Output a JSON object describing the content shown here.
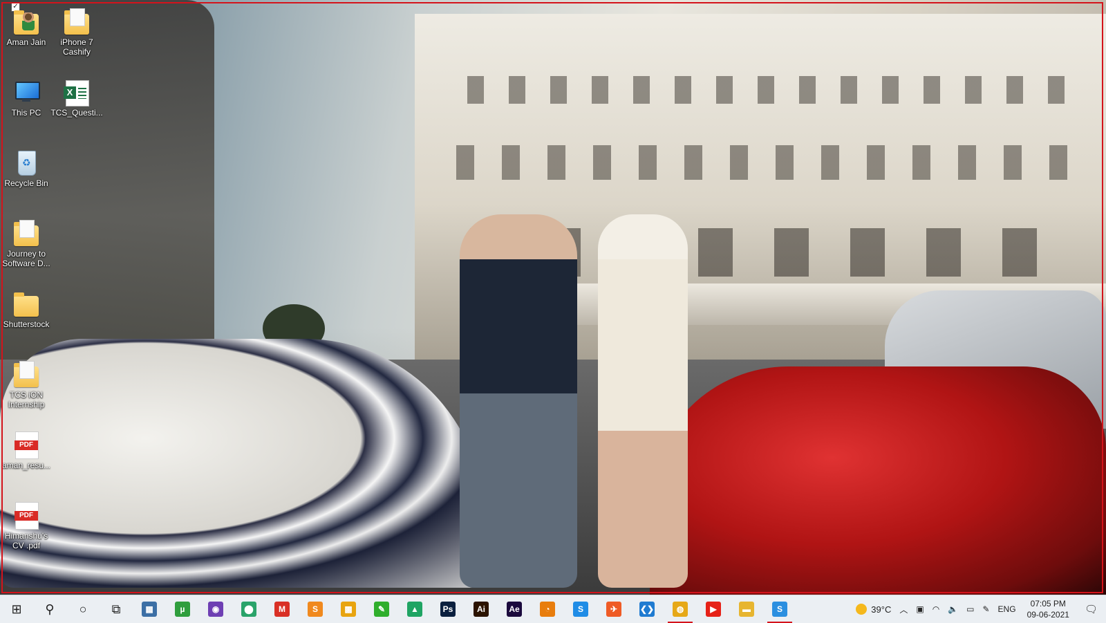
{
  "desktop": {
    "icons": [
      {
        "label": "Aman Jain",
        "icon": "user-folder-icon"
      },
      {
        "label": "iPhone 7 Cashify",
        "icon": "folder-icon"
      },
      {
        "label": "This PC",
        "icon": "this-pc-icon"
      },
      {
        "label": "TCS_Questi...",
        "icon": "excel-file-icon"
      },
      {
        "label": "Recycle Bin",
        "icon": "recycle-bin-icon"
      },
      {
        "label": "Journey to Software D...",
        "icon": "folder-icon"
      },
      {
        "label": "Shutterstock",
        "icon": "folder-icon"
      },
      {
        "label": "TCS iON Internship",
        "icon": "folder-icon"
      },
      {
        "label": "aman_resu...",
        "icon": "pdf-file-icon",
        "badge": "PDF"
      },
      {
        "label": "Himanshu's CV .pdf",
        "icon": "pdf-file-icon",
        "badge": "PDF"
      }
    ],
    "accent_color": "#d4131b"
  },
  "taskbar": {
    "apps": [
      {
        "name": "start-button",
        "icon": "windows-logo-icon",
        "glyph": "⊞",
        "color": "#1f1f1f"
      },
      {
        "name": "search-button",
        "icon": "search-icon",
        "glyph": "⚲",
        "color": "#1f1f1f"
      },
      {
        "name": "cortana-button",
        "icon": "cortana-circle-icon",
        "glyph": "○",
        "color": "#1f1f1f"
      },
      {
        "name": "task-view-button",
        "icon": "task-view-icon",
        "glyph": "⧉",
        "color": "#1f1f1f"
      },
      {
        "name": "calculator",
        "icon": "calculator-icon",
        "glyph": "▦",
        "color": "#3c6fa5"
      },
      {
        "name": "utorrent",
        "icon": "utorrent-icon",
        "glyph": "µ",
        "color": "#2f9e3d"
      },
      {
        "name": "github-desktop",
        "icon": "github-icon",
        "glyph": "◉",
        "color": "#6e3fb3"
      },
      {
        "name": "maps",
        "icon": "maps-pin-icon",
        "glyph": "⬤",
        "color": "#2aa36a"
      },
      {
        "name": "gmail",
        "icon": "gmail-icon",
        "glyph": "M",
        "color": "#d93025"
      },
      {
        "name": "sublime-text",
        "icon": "sublime-text-icon",
        "glyph": "S",
        "color": "#f0891e"
      },
      {
        "name": "microsoft-store",
        "icon": "store-icon",
        "glyph": "▩",
        "color": "#e8a40f"
      },
      {
        "name": "evernote-like",
        "icon": "green-note-icon",
        "glyph": "✎",
        "color": "#2fae2c"
      },
      {
        "name": "google-drive",
        "icon": "google-drive-icon",
        "glyph": "▲",
        "color": "#1fa463"
      },
      {
        "name": "photoshop",
        "icon": "photoshop-icon",
        "glyph": "Ps",
        "color": "#0a1f3e"
      },
      {
        "name": "illustrator",
        "icon": "illustrator-icon",
        "glyph": "Ai",
        "color": "#2b1300"
      },
      {
        "name": "after-effects",
        "icon": "after-effects-icon",
        "glyph": "Ae",
        "color": "#1b0a3d"
      },
      {
        "name": "blender",
        "icon": "blender-icon",
        "glyph": "◔",
        "color": "#e87d0d"
      },
      {
        "name": "skype-like",
        "icon": "blue-s-icon",
        "glyph": "S",
        "color": "#1f8ce6"
      },
      {
        "name": "postman",
        "icon": "postman-icon",
        "glyph": "✈",
        "color": "#ef5b25"
      },
      {
        "name": "vs-code",
        "icon": "vscode-icon",
        "glyph": "❮❯",
        "color": "#1f7bd1"
      },
      {
        "name": "chrome",
        "icon": "chrome-icon",
        "glyph": "◍",
        "color": "#e6a817"
      },
      {
        "name": "youtube",
        "icon": "youtube-icon",
        "glyph": "▶",
        "color": "#e62117"
      },
      {
        "name": "file-explorer",
        "icon": "folder-icon",
        "glyph": "▬",
        "color": "#e7b530"
      },
      {
        "name": "blue-app",
        "icon": "blue-s-icon",
        "glyph": "S",
        "color": "#2b8fe0"
      }
    ],
    "active_apps": [
      "chrome",
      "blue-app"
    ],
    "tray": {
      "weather_temp": "39°C",
      "language": "ENG",
      "time": "07:05 PM",
      "date": "09-06-2021"
    }
  }
}
